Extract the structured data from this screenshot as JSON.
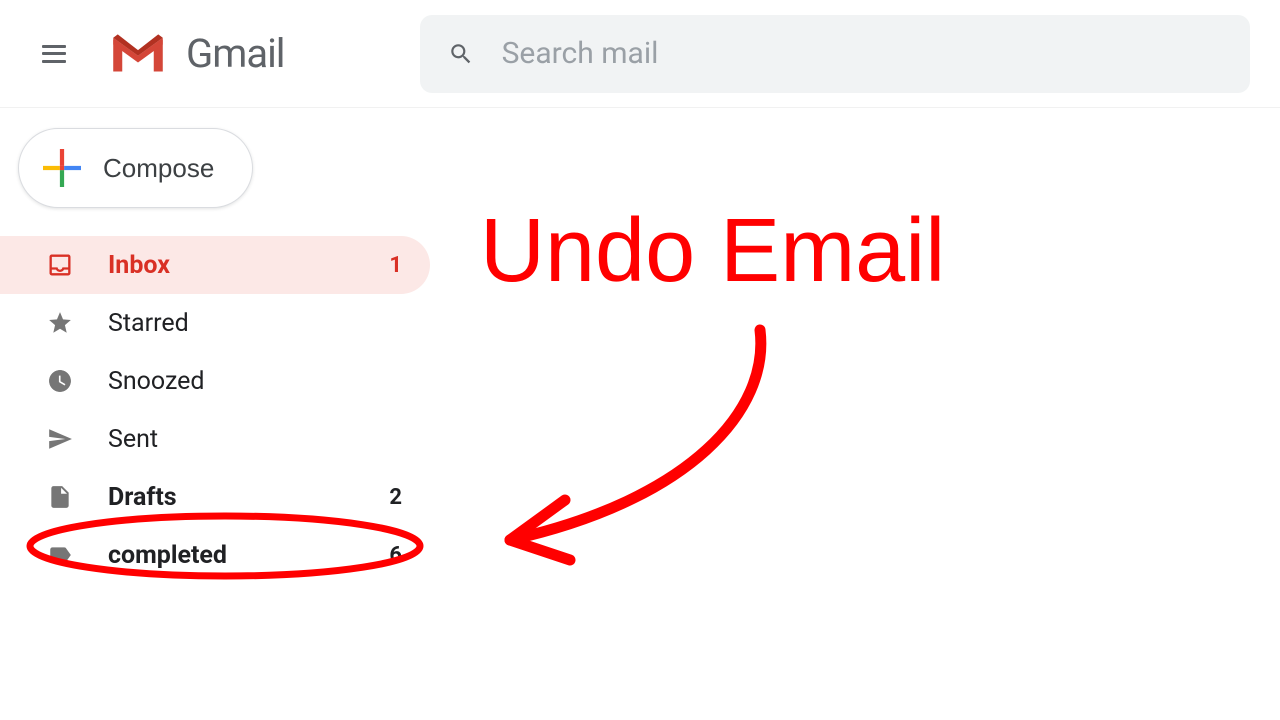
{
  "header": {
    "app_name": "Gmail",
    "search_placeholder": "Search mail"
  },
  "compose": {
    "label": "Compose"
  },
  "sidebar": {
    "items": [
      {
        "id": "inbox",
        "label": "Inbox",
        "count": "1",
        "active": true,
        "bold": true
      },
      {
        "id": "starred",
        "label": "Starred",
        "count": "",
        "active": false,
        "bold": false
      },
      {
        "id": "snoozed",
        "label": "Snoozed",
        "count": "",
        "active": false,
        "bold": false
      },
      {
        "id": "sent",
        "label": "Sent",
        "count": "",
        "active": false,
        "bold": false
      },
      {
        "id": "drafts",
        "label": "Drafts",
        "count": "2",
        "active": false,
        "bold": true
      },
      {
        "id": "completed",
        "label": "completed",
        "count": "6",
        "active": false,
        "bold": true
      }
    ]
  },
  "annotation": {
    "text": "Undo Email"
  },
  "colors": {
    "accent_red": "#d93025",
    "annotation_red": "#ff0000",
    "google_red": "#EA4335",
    "google_blue": "#4285F4",
    "google_green": "#34A853",
    "google_yellow": "#FBBC05"
  }
}
